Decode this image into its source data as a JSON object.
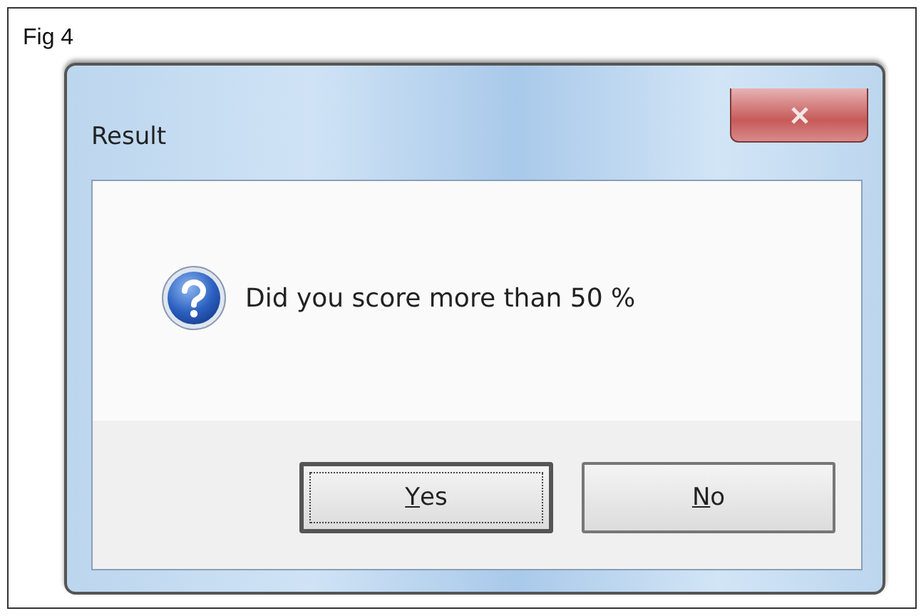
{
  "figure_label": "Fig 4",
  "window": {
    "title": "Result",
    "message": "Did you score more than 50 %"
  },
  "buttons": [
    {
      "label": "Yes",
      "focused": true
    },
    {
      "label": "No",
      "focused": false
    }
  ]
}
